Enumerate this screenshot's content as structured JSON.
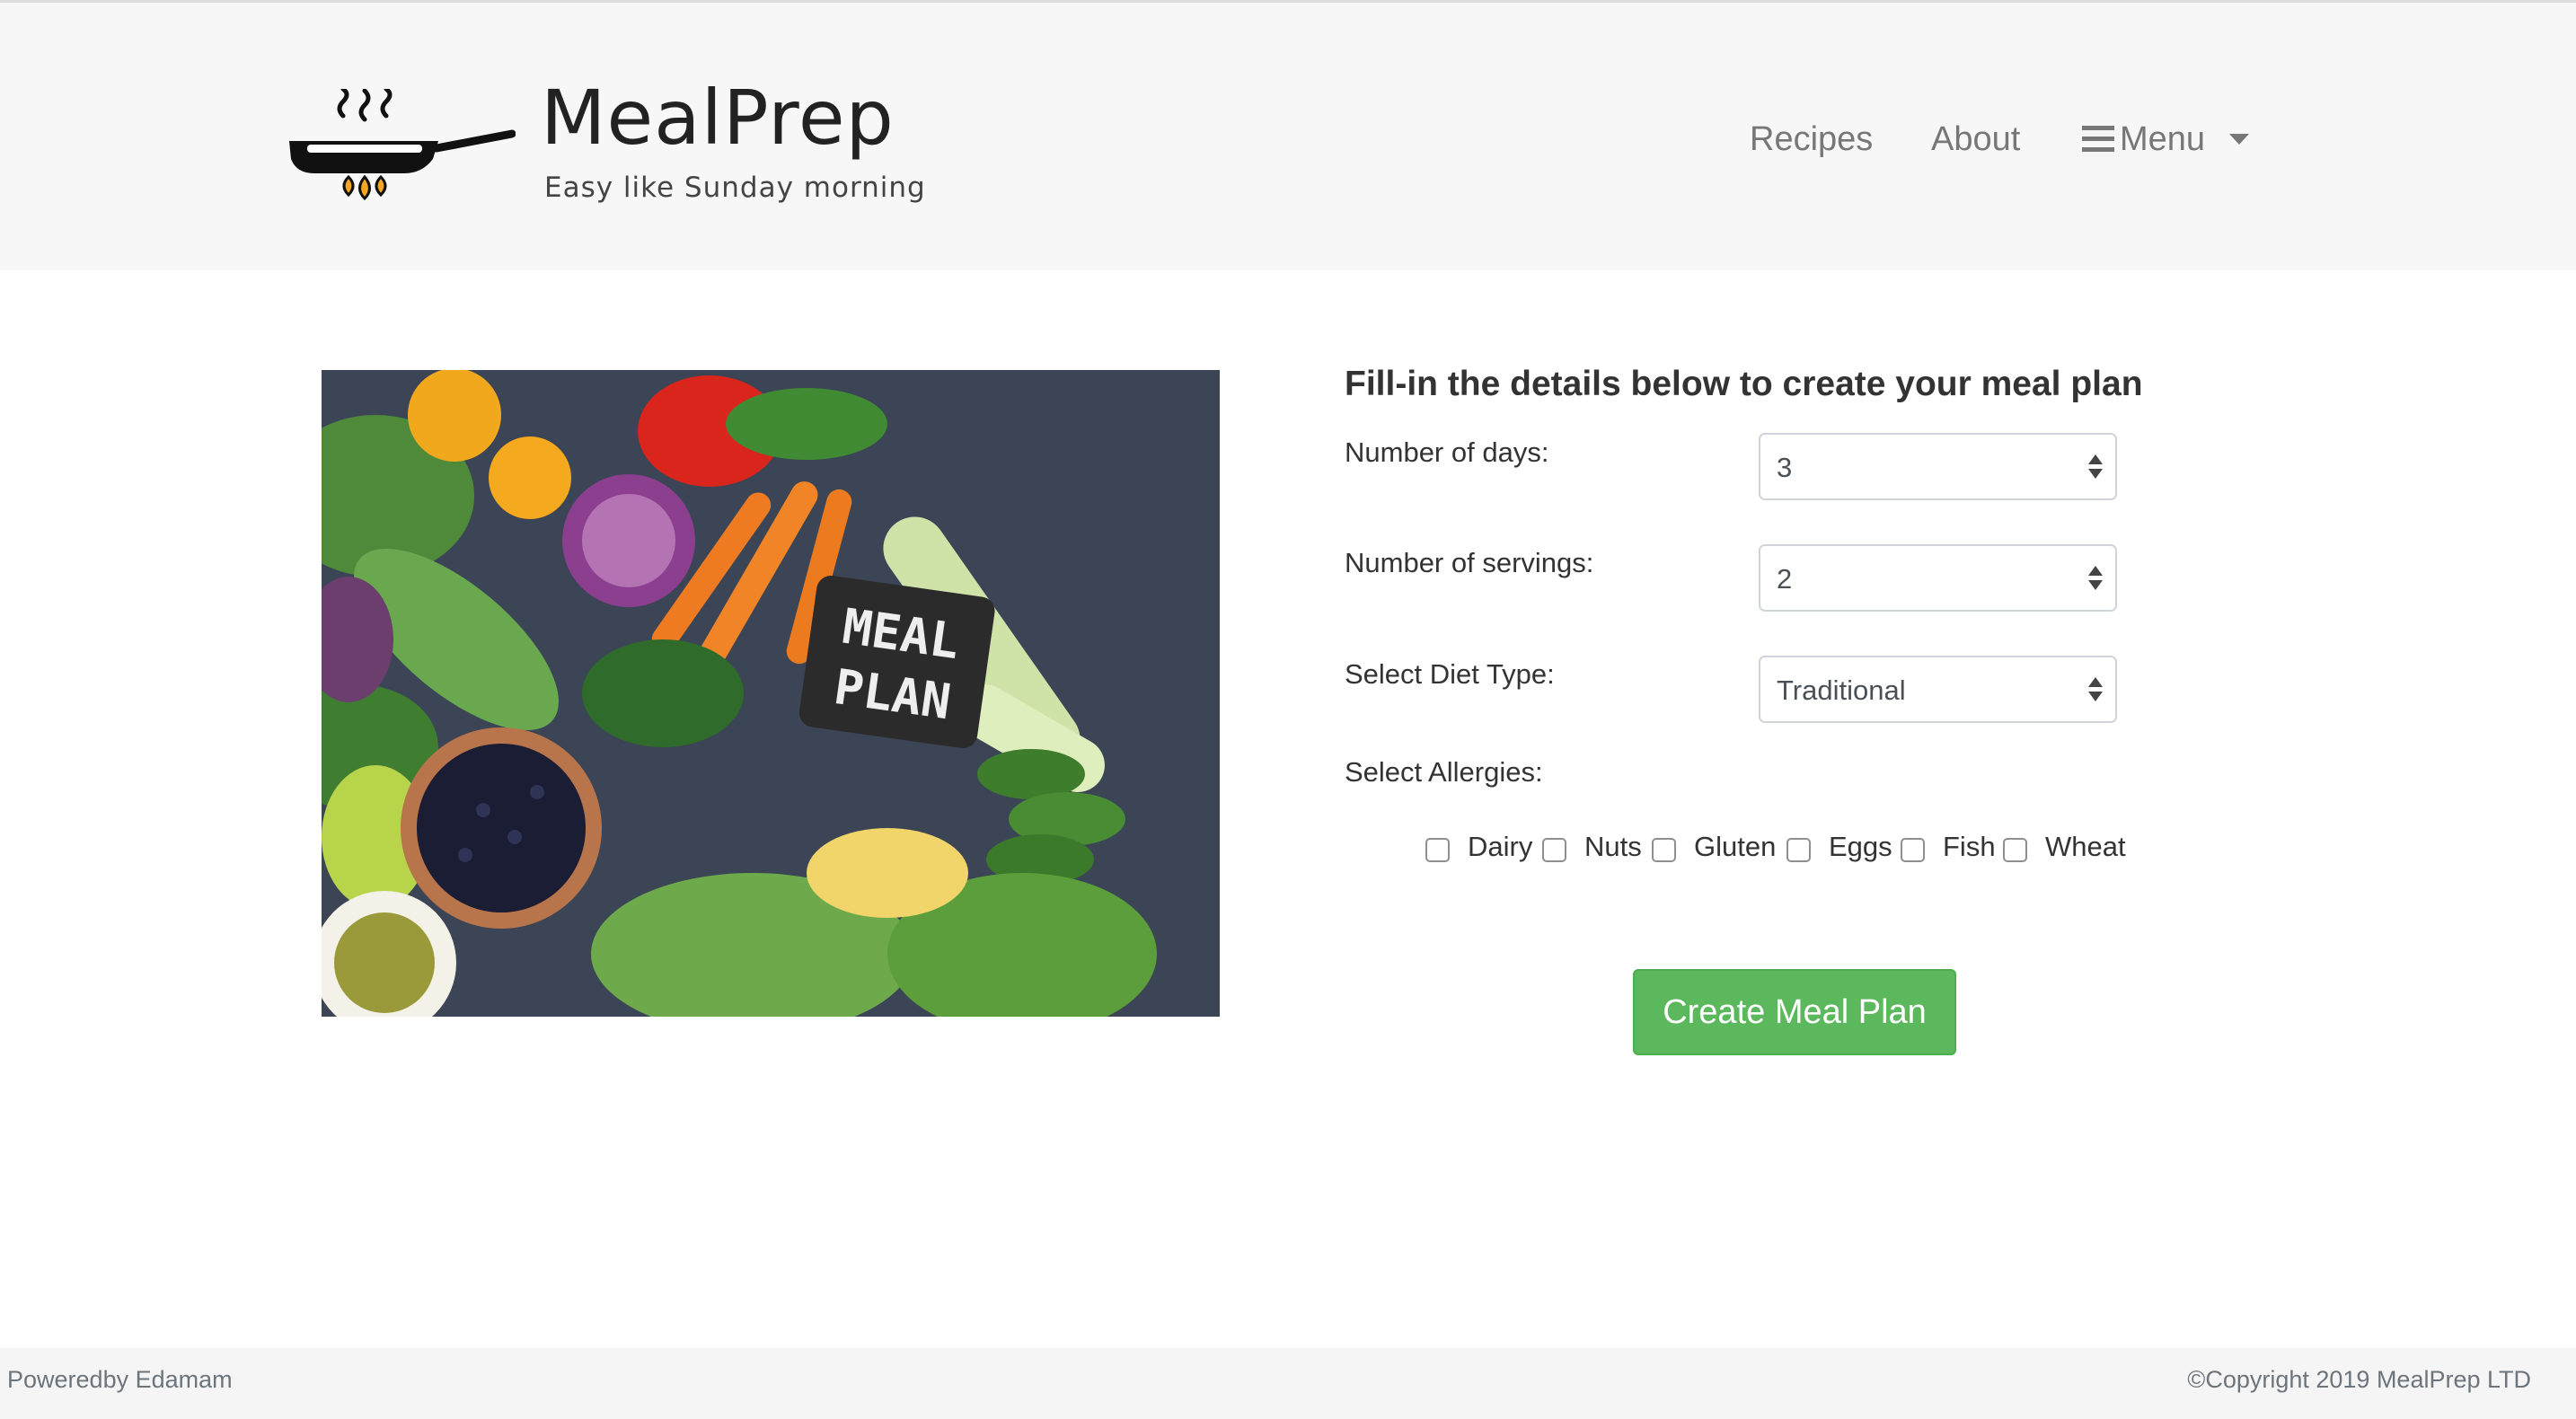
{
  "brand": {
    "name": "MealPrep",
    "tagline": "Easy like Sunday morning"
  },
  "nav": {
    "recipes": "Recipes",
    "about": "About",
    "menu": "Menu"
  },
  "hero": {
    "sign_line1": "MEAL",
    "sign_line2": "PLAN"
  },
  "form": {
    "title": "Fill-in the details below to create your meal plan",
    "days_label": "Number of days:",
    "days_value": "3",
    "servings_label": "Number of servings:",
    "servings_value": "2",
    "diet_label": "Select Diet Type:",
    "diet_value": "Traditional",
    "allergies_label": "Select Allergies:",
    "allergies": [
      "Dairy",
      "Nuts",
      "Gluten",
      "Eggs",
      "Fish",
      "Wheat"
    ],
    "submit": "Create Meal Plan"
  },
  "footer": {
    "left": "Poweredby Edamam",
    "right": "©Copyright 2019 MealPrep LTD"
  },
  "colors": {
    "navbar_bg": "#f7f7f7",
    "button_green": "#5cb85c",
    "nav_text": "#777777"
  }
}
